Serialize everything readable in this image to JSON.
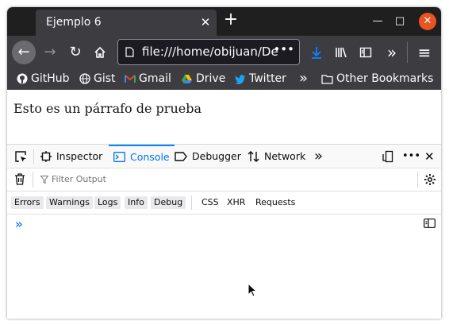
{
  "window": {
    "tab_title": "Ejemplo 6",
    "close_glyph": "✕",
    "new_tab_glyph": "+",
    "minimize_glyph": "—",
    "maximize_glyph": "□",
    "window_close_glyph": "✕"
  },
  "navbar": {
    "url": "file:///home/obijuan/De",
    "url_more": "•••",
    "back_glyph": "←",
    "forward_glyph": "→",
    "reload_glyph": "↻",
    "overflow_glyph": "»",
    "menu_glyph": "≡"
  },
  "bookmarks": {
    "items": [
      "GitHub",
      "Gist",
      "Gmail",
      "Drive",
      "Twitter"
    ],
    "overflow_glyph": "»",
    "other": "Other Bookmarks"
  },
  "page": {
    "paragraph": "Esto es un párrafo de prueba"
  },
  "devtools": {
    "tabs": [
      "Inspector",
      "Console",
      "Debugger",
      "Network"
    ],
    "active_tab": "Console",
    "overflow_glyph": "»",
    "more_glyph": "•••",
    "close_glyph": "✕",
    "filter_placeholder": "Filter Output",
    "log_levels": [
      "Errors",
      "Warnings",
      "Logs",
      "Info",
      "Debug"
    ],
    "request_types": [
      "CSS",
      "XHR",
      "Requests"
    ],
    "prompt_glyph": "»"
  },
  "colors": {
    "titlebar": "#1f1f1f",
    "toolbar": "#3d3d41",
    "accent": "#0a84ff",
    "window_close": "#e95420"
  }
}
